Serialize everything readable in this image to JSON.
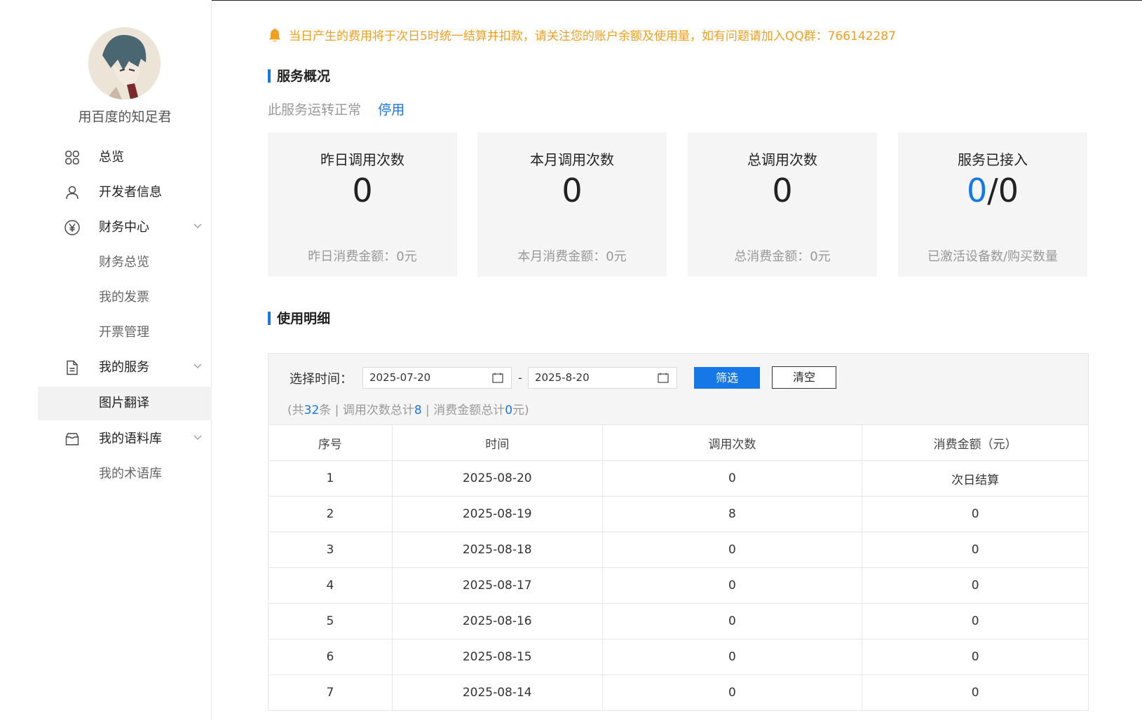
{
  "user": {
    "name": "用百度的知足君"
  },
  "sidebar": {
    "items": [
      {
        "label": "总览",
        "icon": "grid-icon"
      },
      {
        "label": "开发者信息",
        "icon": "user-icon"
      },
      {
        "label": "财务中心",
        "icon": "yen-icon"
      },
      {
        "label": "财务总览"
      },
      {
        "label": "我的发票"
      },
      {
        "label": "开票管理"
      },
      {
        "label": "我的服务",
        "icon": "document-icon"
      },
      {
        "label": "图片翻译"
      },
      {
        "label": "我的语料库",
        "icon": "inbox-icon"
      },
      {
        "label": "我的术语库"
      }
    ]
  },
  "notice": {
    "text": "当日产生的费用将于次日5时统一结算并扣款，请关注您的账户余额及使用量，如有问题请加入QQ群：766142287"
  },
  "overview": {
    "title": "服务概况",
    "status": "此服务运转正常",
    "stop_label": "停用",
    "cards": [
      {
        "title": "昨日调用次数",
        "value": "0",
        "foot": "昨日消费金额：0元"
      },
      {
        "title": "本月调用次数",
        "value": "0",
        "foot": "本月消费金额：0元"
      },
      {
        "title": "总调用次数",
        "value": "0",
        "foot": "总消费金额：0元"
      },
      {
        "title": "服务已接入",
        "value_active": "0",
        "value_sep": "/",
        "value_total": "0",
        "foot": "已激活设备数/购买数量"
      }
    ]
  },
  "usage": {
    "title": "使用明细",
    "filter_label": "选择时间：",
    "date_from": "2025-07-20",
    "date_sep": "-",
    "date_to": "2025-8-20",
    "filter_button": "筛选",
    "clear_button": "清空",
    "summary": {
      "p1": "(共",
      "count": "32",
      "p2": "条 | 调用次数总计",
      "calls": "8",
      "p3": " | 消费金额总计",
      "amount": "0",
      "p4": "元)"
    },
    "columns": [
      "序号",
      "时间",
      "调用次数",
      "消费金额（元）"
    ],
    "rows": [
      [
        "1",
        "2025-08-20",
        "0",
        "次日结算"
      ],
      [
        "2",
        "2025-08-19",
        "8",
        "0"
      ],
      [
        "3",
        "2025-08-18",
        "0",
        "0"
      ],
      [
        "4",
        "2025-08-17",
        "0",
        "0"
      ],
      [
        "5",
        "2025-08-16",
        "0",
        "0"
      ],
      [
        "6",
        "2025-08-15",
        "0",
        "0"
      ],
      [
        "7",
        "2025-08-14",
        "0",
        "0"
      ]
    ]
  },
  "colors": {
    "accent": "#1677e6",
    "notice": "#f0a020",
    "card_bg": "#f5f5f5"
  }
}
